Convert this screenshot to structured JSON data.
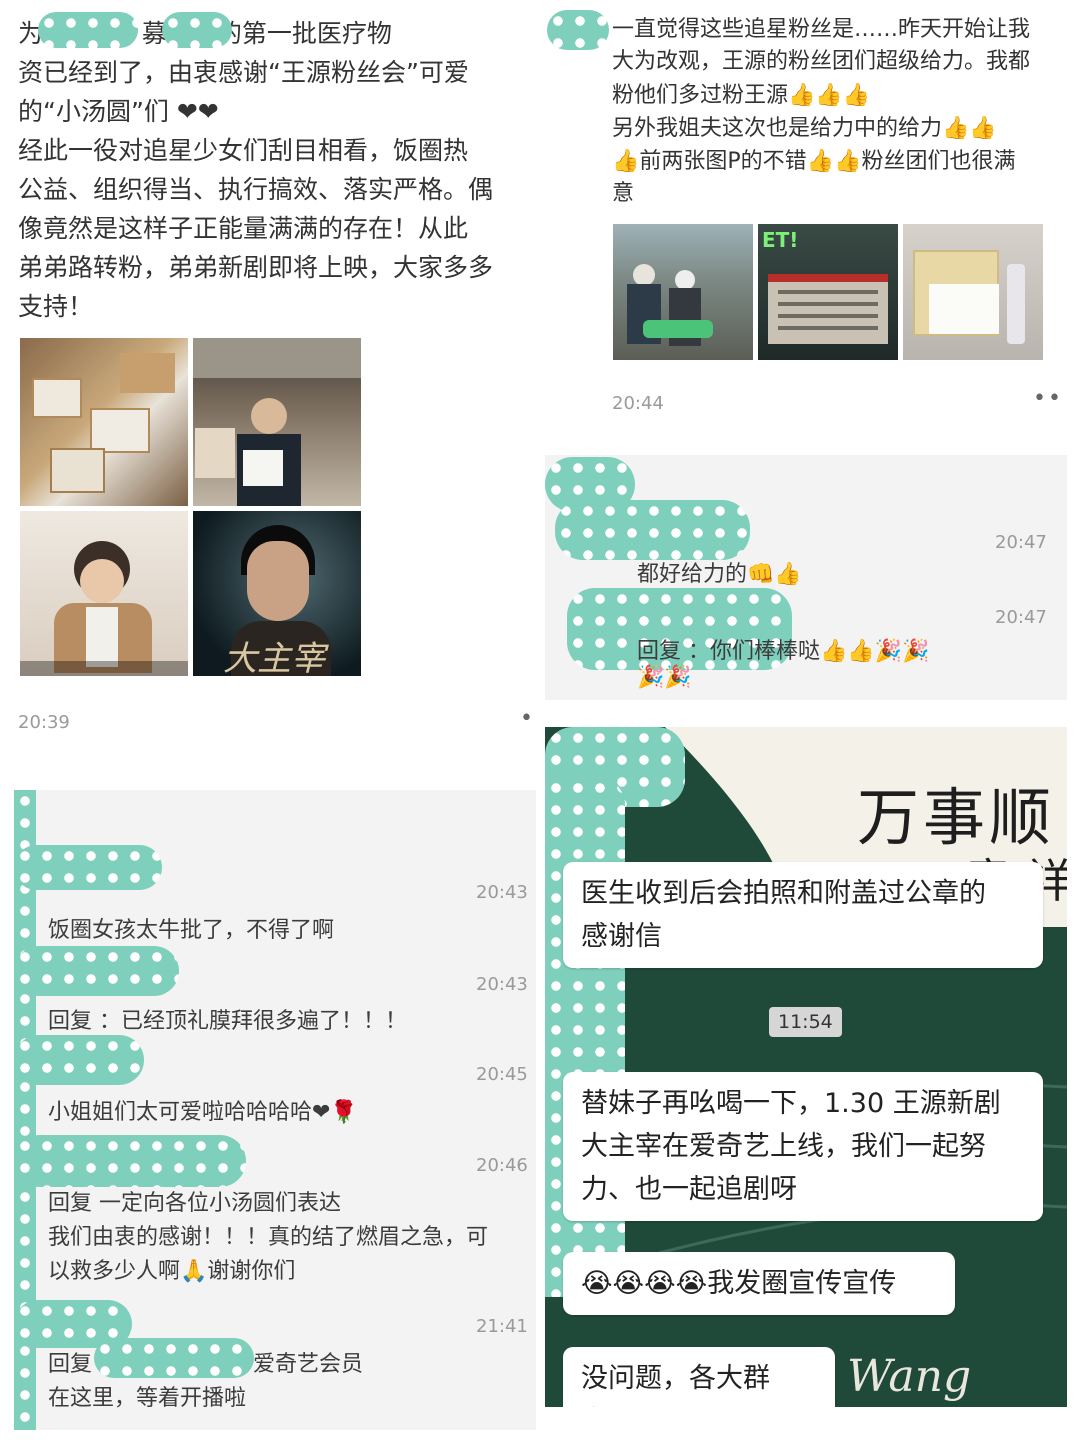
{
  "panel_tl": {
    "line1": "为 具和 县 募集到的第一批医疗物",
    "line2": "资已经到了，由衷感谢“王源粉丝会”可爱",
    "line3": "的“小汤圆”们 ❤❤",
    "line4": "经此一役对追星少女们刮目相看，饭圈热",
    "line5": "公益、组织得当、执行搞效、落实严格。偶",
    "line6": "像竟然是这样子正能量满满的存在！从此",
    "line7": "弟弟路转粉，弟弟新剧即将上映，大家多多",
    "line8": "支持！",
    "time": "20:39",
    "more": "•",
    "images": {
      "poster_text": "大主宰"
    }
  },
  "panel_tr": {
    "line1": "一直觉得这些追星粉丝是……昨天开始让我",
    "line2": "大为改观，王源的粉丝团们超级给力。我都",
    "line3": "粉他们多过粉王源👍👍👍",
    "line4": "另外我姐夫这次也是给力中的给力👍👍",
    "line5": "👍前两张图P的不错👍👍粉丝团们也很满",
    "line6": "意",
    "time": "20:44",
    "more": "••",
    "images": {
      "photo_text": "ET!"
    }
  },
  "panel_ml": {
    "items": [
      {
        "time": "20:43",
        "text": "饭圈女孩太牛批了，不得了啊"
      },
      {
        "time": "20:43",
        "text": "回复        ：已经顶礼膜拜很多遍了！！！"
      },
      {
        "time": "20:45",
        "text": "小姐姐们太可爱啦哈哈哈哈❤🌹"
      },
      {
        "time": "20:46",
        "text": "回复        一定向各位小汤圆们表达"
      },
      {
        "time": "",
        "text": "我们由衷的感谢！！！真的结了燃眉之急，可"
      },
      {
        "time": "",
        "text": "以救多少人啊🙏谢谢你们"
      },
      {
        "time": "21:41",
        "text": "回复        向粉丝团致敬！爱奇艺会员"
      },
      {
        "time": "",
        "text": "在这里，等着开播啦"
      }
    ]
  },
  "panel_mr": {
    "items": [
      {
        "time": "20:47",
        "text": "都好给力的👊👍"
      },
      {
        "time": "20:47",
        "text": "回复        ：你们棒棒哒👍👍🎉🎉"
      },
      {
        "time": "",
        "text": "🎉🎉"
      }
    ]
  },
  "panel_br": {
    "bg_calligraphy": "万事顺",
    "bg_calligraphy2": "意  祥",
    "bg_signature": "Wang",
    "bubble1": "医生收到后会拍照和附盖过公章的\n感谢信",
    "time": "11:54",
    "bubble2": "替妹子再吆喝一下，1.30 王源新剧\n大主宰在爱奇艺上线，我们一起努\n力、也一起追剧呀",
    "bubble3": "😭😭😭😭我发圈宣传宣传",
    "bubble4": "没问题，各大群发！"
  },
  "colors": {
    "mosaic": "#7fcfbd",
    "dark_green": "#1f4a3a",
    "time_gray": "#9a9a9a"
  }
}
